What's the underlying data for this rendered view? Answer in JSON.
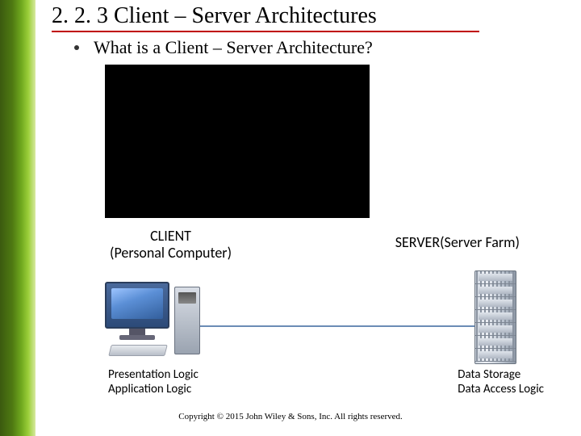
{
  "title": "2. 2. 3 Client – Server Architectures",
  "bullet": "What is a Client – Server Architecture?",
  "diagram": {
    "client_title": "CLIENT",
    "client_sub": "(Personal Computer)",
    "server_title": "SERVER(Server Farm)",
    "client_logic1": "Presentation Logic",
    "client_logic2": "Application Logic",
    "server_logic1": "Data Storage",
    "server_logic2": "Data Access Logic"
  },
  "copyright": "Copyright © 2015 John Wiley & Sons, Inc. All rights reserved."
}
